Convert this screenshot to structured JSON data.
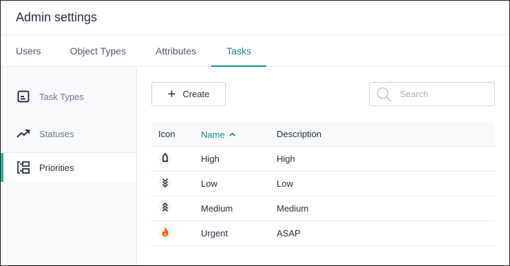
{
  "header": {
    "title": "Admin settings"
  },
  "tabs": [
    {
      "label": "Users"
    },
    {
      "label": "Object Types"
    },
    {
      "label": "Attributes"
    },
    {
      "label": "Tasks",
      "active": true
    }
  ],
  "sidebar": {
    "items": [
      {
        "label": "Task Types",
        "icon": "task-types-icon"
      },
      {
        "label": "Statuses",
        "icon": "trend-icon"
      },
      {
        "label": "Priorities",
        "icon": "priorities-icon",
        "active": true
      }
    ]
  },
  "toolbar": {
    "create_label": "Create"
  },
  "search": {
    "placeholder": "Search"
  },
  "table": {
    "columns": {
      "icon": "Icon",
      "name": "Name",
      "description": "Description"
    },
    "sorted_by": "name",
    "sort_direction": "ascending",
    "rows": [
      {
        "icon": "high-priority-icon",
        "name": "High",
        "description": "High"
      },
      {
        "icon": "low-priority-icon",
        "name": "Low",
        "description": "Low"
      },
      {
        "icon": "medium-priority-icon",
        "name": "Medium",
        "description": "Medium"
      },
      {
        "icon": "urgent-flame-icon",
        "name": "Urgent",
        "description": "ASAP"
      }
    ]
  },
  "colors": {
    "accent": "#1a8a8a",
    "active_marker": "#2bb09c",
    "border": "#e6eaee",
    "urgent": "#f05a28"
  }
}
